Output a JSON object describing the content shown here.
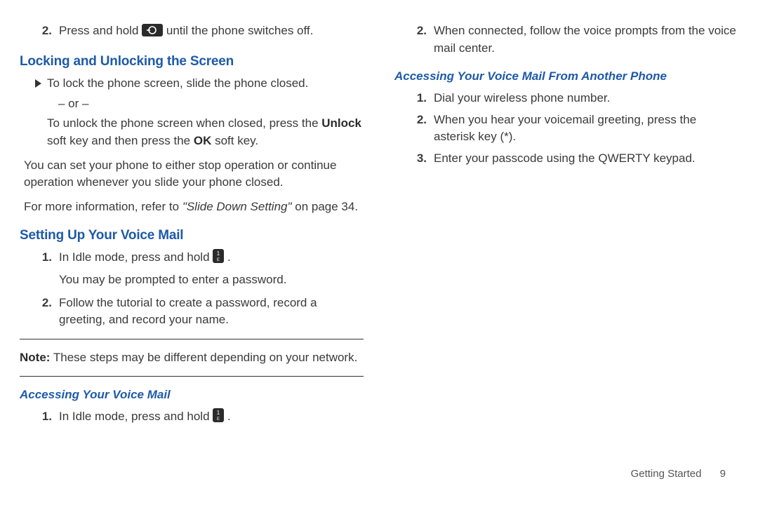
{
  "left": {
    "step2_a": "Press and hold ",
    "step2_b": " until the phone switches off.",
    "h_lock": "Locking and Unlocking the Screen",
    "lock_bullet": "To lock the phone screen, slide the phone closed.",
    "or": "– or –",
    "unlock_a": "To unlock the phone screen when closed, press the ",
    "unlock_bold1": "Unlock",
    "unlock_mid": " soft key and then press the ",
    "unlock_bold2": "OK",
    "unlock_end": " soft key.",
    "slide_para": "You can set your phone to either stop operation or continue operation whenever you slide your phone closed.",
    "refer_a": "For more information, refer to ",
    "refer_quote": "\"Slide Down Setting\"",
    "refer_b": "  on page 34.",
    "h_vm": "Setting Up Your Voice Mail",
    "vm1_a": "In Idle mode, press and hold ",
    "vm1_b": ".",
    "vm1_line2": "You may be prompted to enter a password.",
    "vm2": "Follow the tutorial to create a password, record a greeting, and record your name.",
    "note_label": "Note:",
    "note_body": " These steps may be different depending on your network.",
    "h_access": "Accessing Your Voice Mail",
    "access1_a": "In Idle mode, press and hold ",
    "access1_b": "."
  },
  "right": {
    "step2": "When connected, follow the voice prompts from the voice mail center.",
    "h_other": "Accessing Your Voice Mail From Another Phone",
    "o1": "Dial your wireless phone number.",
    "o2": "When you hear your voicemail greeting, press the asterisk key (*).",
    "o3": "Enter your passcode using the QWERTY keypad."
  },
  "footer": {
    "section": "Getting Started",
    "page": "9"
  },
  "nums": {
    "n1": "1.",
    "n2": "2.",
    "n3": "3."
  }
}
